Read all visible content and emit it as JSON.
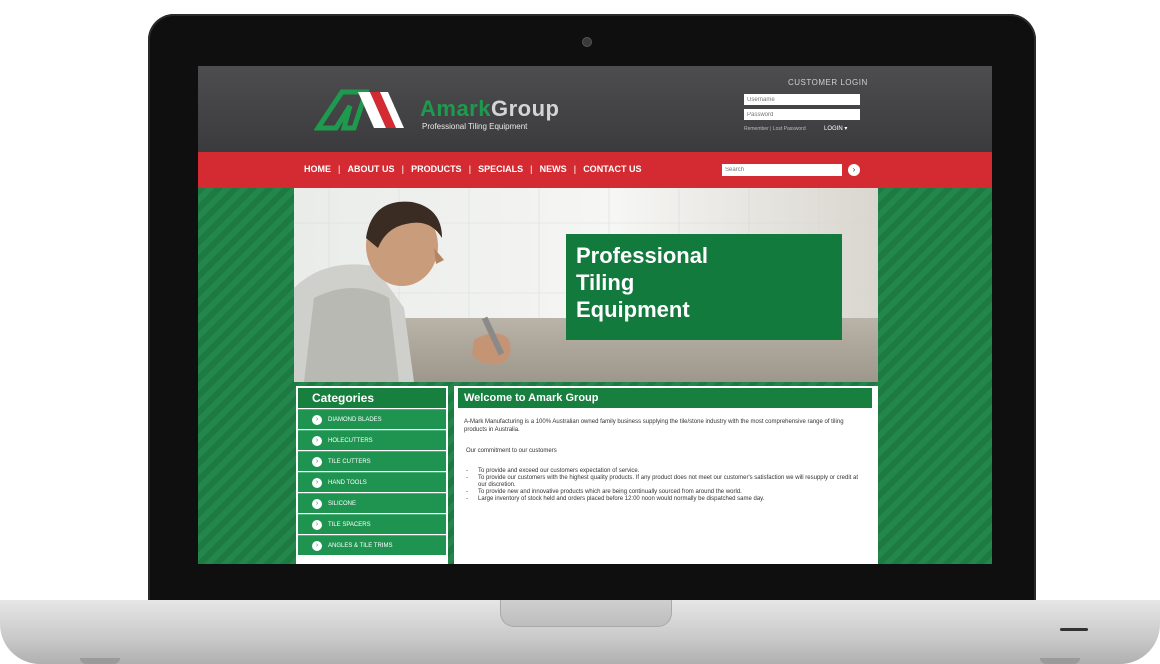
{
  "site": {
    "brand": {
      "amark": "Amark",
      "group": "Group",
      "tagline": "Professional Tiling Equipment"
    },
    "login": {
      "title": "CUSTOMER LOGIN",
      "username_placeholder": "Username",
      "password_placeholder": "Password",
      "forgot": "Remember | Lost Password",
      "button": "LOGIN"
    },
    "nav": [
      "HOME",
      "ABOUT US",
      "PRODUCTS",
      "SPECIALS",
      "NEWS",
      "CONTACT US"
    ],
    "nav_separator": "|",
    "search_placeholder": "Search",
    "hero_title": "Professional\nTiling\nEquipment",
    "categories_title": "Categories",
    "categories": [
      "DIAMOND BLADES",
      "HOLECUTTERS",
      "TILE CUTTERS",
      "HAND TOOLS",
      "SILICONE",
      "TILE SPACERS",
      "ANGLES & TILE TRIMS"
    ],
    "welcome_title": "Welcome to Amark Group",
    "intro": "A-Mark Manufacturing is a 100% Australian owned family business supplying the tile/stone industry with the most comprehensive range of tiling products in Australia.",
    "commitment": "Our commitment to our customers",
    "commitments": [
      "To provide and exceed our customers expectation of service.",
      "To provide our customers with the highest quality products. If any product does not meet our customer's satisfaction we will resupply or credit at our discretion.",
      "To provide new and innovative products which are being continually sourced from around the world.",
      "Large inventory of stock held and orders placed before 12:00 noon would normally be dispatched same day."
    ]
  },
  "colors": {
    "brand_green": "#17803f",
    "nav_red": "#d42a32",
    "header_grey": "#444446"
  },
  "icons": {
    "bullet": "arrow-right-circle-icon",
    "search": "search-go-icon",
    "login": "dropdown-arrow-icon"
  }
}
